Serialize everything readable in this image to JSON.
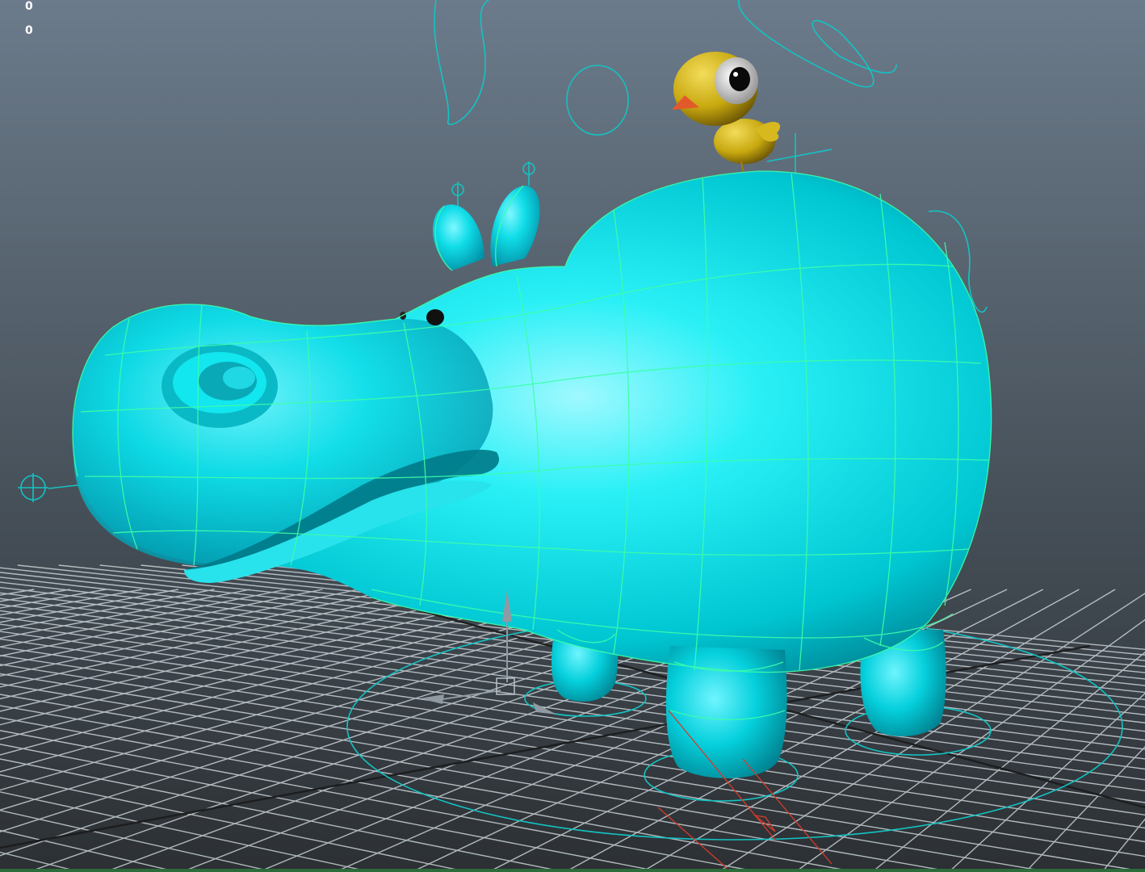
{
  "viewport": {
    "hud_lines": [
      "0",
      "0"
    ]
  },
  "colors": {
    "bg_top": "#6b7b8b",
    "bg_bottom": "#2c3034",
    "grid": "#c9d2d6",
    "hippo_body": "#00e5ec",
    "wireframe": "#3dffa8",
    "rig_controls": "#13c3c3",
    "bird_body": "#c8a80f",
    "bird_beak": "#e35a2a",
    "joint_lines": "#d83a2a"
  },
  "icons": [
    "locator-cross-icon",
    "move-manipulator-icon"
  ]
}
